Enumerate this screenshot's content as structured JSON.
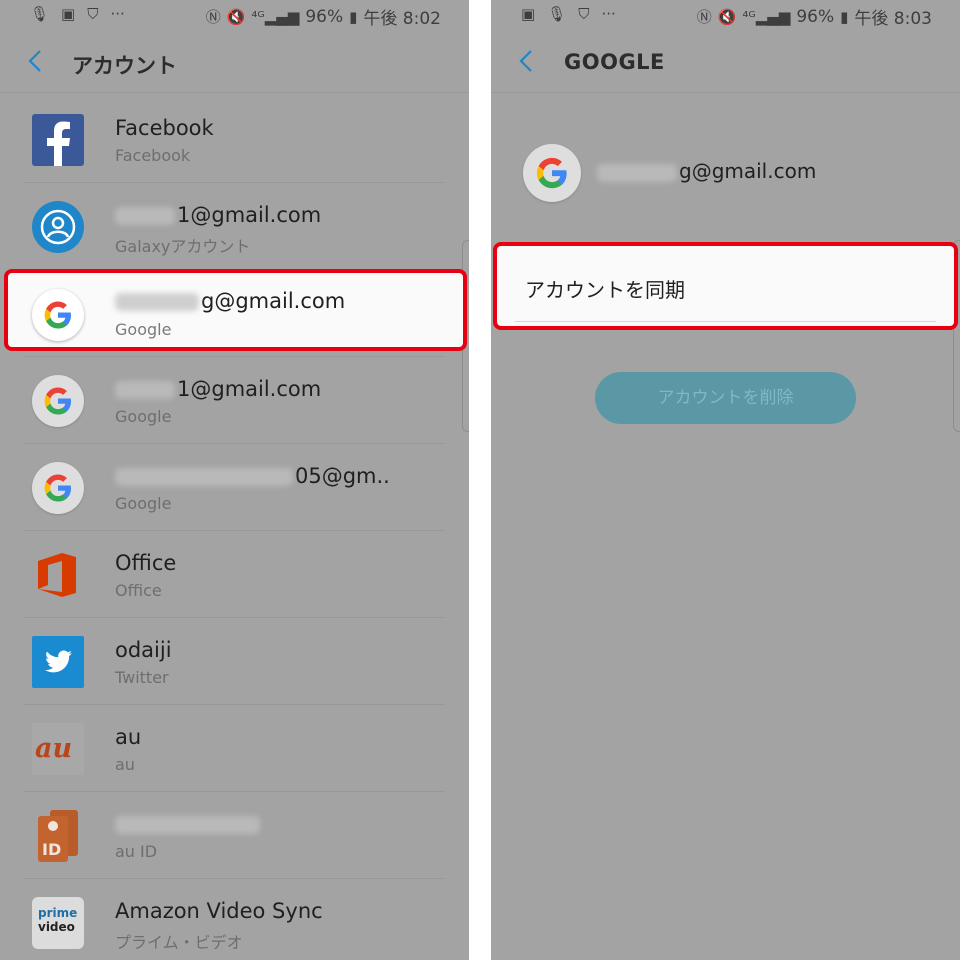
{
  "left": {
    "status": {
      "battery": "96%",
      "time": "午後 8:02"
    },
    "title": "アカウント",
    "accounts": [
      {
        "primary": "Facebook",
        "secondary": "Facebook",
        "icon": "facebook-icon"
      },
      {
        "primary": "1@gmail.com",
        "secondary": "Galaxyアカウント",
        "icon": "samsung-account-icon"
      },
      {
        "primary": "g@gmail.com",
        "secondary": "Google",
        "icon": "google-icon"
      },
      {
        "primary": "1@gmail.com",
        "secondary": "Google",
        "icon": "google-icon"
      },
      {
        "primary": "05@gm..",
        "secondary": "Google",
        "icon": "google-icon"
      },
      {
        "primary": "Office",
        "secondary": "Office",
        "icon": "office-icon"
      },
      {
        "primary": "odaiji",
        "secondary": "Twitter",
        "icon": "twitter-icon"
      },
      {
        "primary": "au",
        "secondary": "au",
        "icon": "au-icon"
      },
      {
        "primary": "",
        "secondary": "au ID",
        "icon": "au-id-icon"
      },
      {
        "primary": "Amazon Video Sync",
        "secondary": "プライム・ビデオ",
        "icon": "prime-video-icon"
      }
    ],
    "icon_text": {
      "au": "au",
      "id": "ID",
      "prime": "prime",
      "video": "video"
    }
  },
  "right": {
    "status": {
      "battery": "96%",
      "time": "午後 8:03"
    },
    "title": "GOOGLE",
    "account_email": "g@gmail.com",
    "sync_label": "アカウントを同期",
    "remove_label": "アカウントを削除"
  },
  "colors": {
    "highlight": "#e60012",
    "facebook": "#3b5998",
    "twitter": "#1da1f2",
    "office": "#d83b01",
    "au": "#eb5505",
    "accent": "#1f86c9"
  }
}
